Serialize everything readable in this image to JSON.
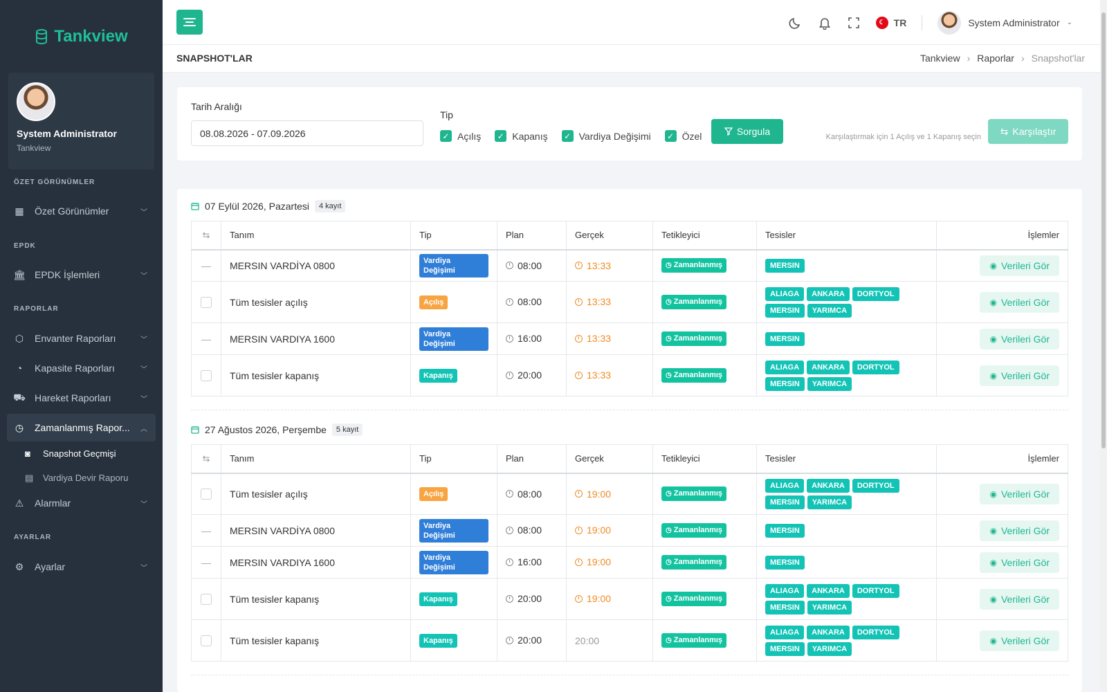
{
  "brand": {
    "name": "Tankview"
  },
  "profile": {
    "name": "System Administrator",
    "org": "Tankview"
  },
  "sidebar": {
    "sections": [
      {
        "title": "ÖZET GÖRÜNÜMLER",
        "items": [
          {
            "label": "Özet Görünümler",
            "icon": "dashboard-icon"
          }
        ]
      },
      {
        "title": "EPDK",
        "items": [
          {
            "label": "EPDK İşlemleri",
            "icon": "bank-icon"
          }
        ]
      },
      {
        "title": "RAPORLAR",
        "items": [
          {
            "label": "Envanter Raporları",
            "icon": "box-icon"
          },
          {
            "label": "Kapasite Raporları",
            "icon": "gauge-icon"
          },
          {
            "label": "Hareket Raporları",
            "icon": "truck-icon"
          },
          {
            "label": "Zamanlanmış Rapor...",
            "icon": "clock-icon",
            "active": true,
            "children": [
              {
                "label": "Snapshot Geçmişi",
                "icon": "camera-icon",
                "active": true
              },
              {
                "label": "Vardiya Devir Raporu",
                "icon": "clipboard-icon"
              }
            ]
          },
          {
            "label": "Alarmlar",
            "icon": "warning-icon"
          }
        ]
      },
      {
        "title": "AYARLAR",
        "items": [
          {
            "label": "Ayarlar",
            "icon": "gear-icon"
          }
        ]
      }
    ]
  },
  "topbar": {
    "language": "TR",
    "user_name": "System Administrator"
  },
  "page": {
    "title": "SNAPSHOT'LAR",
    "breadcrumb": [
      "Tankview",
      "Raporlar",
      "Snapshot'lar"
    ]
  },
  "filter": {
    "date_label": "Tarih Aralığı",
    "date_value": "08.08.2026 - 07.09.2026",
    "type_label": "Tip",
    "types": [
      "Açılış",
      "Kapanış",
      "Vardiya Değişimi",
      "Özel"
    ],
    "query_button": "Sorgula",
    "hint": "Karşılaştırmak için 1 Açılış ve 1 Kapanış seçin",
    "compare_button": "Karşılaştır"
  },
  "table": {
    "columns": [
      "Tanım",
      "Tip",
      "Plan",
      "Gerçek",
      "Tetikleyici",
      "Tesisler",
      "İşlemler"
    ],
    "view_button": "Verileri Gör"
  },
  "groups": [
    {
      "date": "07 Eylül 2026, Pazartesi",
      "count": "4 kayıt",
      "rows": [
        {
          "select": "dash",
          "name": "MERSIN VARDİYA 0800",
          "type": "Vardiya Değişimi",
          "type_kind": "vd",
          "plan": "08:00",
          "actual": "13:33",
          "actual_kind": "orange",
          "trigger": "Zamanlanmış",
          "facilities": [
            "MERSIN"
          ]
        },
        {
          "select": "box",
          "name": "Tüm tesisler açılış",
          "type": "Açılış",
          "type_kind": "ac",
          "plan": "08:00",
          "actual": "13:33",
          "actual_kind": "orange",
          "trigger": "Zamanlanmış",
          "facilities": [
            "ALIAGA",
            "ANKARA",
            "DORTYOL",
            "MERSIN",
            "YARIMCA"
          ]
        },
        {
          "select": "dash",
          "name": "MERSIN VARDIYA 1600",
          "type": "Vardiya Değişimi",
          "type_kind": "vd",
          "plan": "16:00",
          "actual": "13:33",
          "actual_kind": "orange",
          "trigger": "Zamanlanmış",
          "facilities": [
            "MERSIN"
          ]
        },
        {
          "select": "box",
          "name": "Tüm tesisler kapanış",
          "type": "Kapanış",
          "type_kind": "kp",
          "plan": "20:00",
          "actual": "13:33",
          "actual_kind": "orange",
          "trigger": "Zamanlanmış",
          "facilities": [
            "ALIAGA",
            "ANKARA",
            "DORTYOL",
            "MERSIN",
            "YARIMCA"
          ]
        }
      ]
    },
    {
      "date": "27 Ağustos 2026, Perşembe",
      "count": "5 kayıt",
      "rows": [
        {
          "select": "box",
          "name": "Tüm tesisler açılış",
          "type": "Açılış",
          "type_kind": "ac",
          "plan": "08:00",
          "actual": "19:00",
          "actual_kind": "orange",
          "trigger": "Zamanlanmış",
          "facilities": [
            "ALIAGA",
            "ANKARA",
            "DORTYOL",
            "MERSIN",
            "YARIMCA"
          ]
        },
        {
          "select": "dash",
          "name": "MERSIN VARDİYA 0800",
          "type": "Vardiya Değişimi",
          "type_kind": "vd",
          "plan": "08:00",
          "actual": "19:00",
          "actual_kind": "orange",
          "trigger": "Zamanlanmış",
          "facilities": [
            "MERSIN"
          ]
        },
        {
          "select": "dash",
          "name": "MERSIN VARDIYA 1600",
          "type": "Vardiya Değişimi",
          "type_kind": "vd",
          "plan": "16:00",
          "actual": "19:00",
          "actual_kind": "orange",
          "trigger": "Zamanlanmış",
          "facilities": [
            "MERSIN"
          ]
        },
        {
          "select": "box",
          "name": "Tüm tesisler kapanış",
          "type": "Kapanış",
          "type_kind": "kp",
          "plan": "20:00",
          "actual": "19:00",
          "actual_kind": "orange",
          "trigger": "Zamanlanmış",
          "facilities": [
            "ALIAGA",
            "ANKARA",
            "DORTYOL",
            "MERSIN",
            "YARIMCA"
          ]
        },
        {
          "select": "box",
          "name": "Tüm tesisler kapanış",
          "type": "Kapanış",
          "type_kind": "kp",
          "plan": "20:00",
          "actual": "20:00",
          "actual_kind": "grey",
          "trigger": "Zamanlanmış",
          "facilities": [
            "ALIAGA",
            "ANKARA",
            "DORTYOL",
            "MERSIN",
            "YARIMCA"
          ]
        }
      ]
    }
  ],
  "colors": {
    "accent": "#1fb68f",
    "sidebar": "#27313d",
    "vardiya": "#2f7ed8",
    "acilis": "#f7a441",
    "kapanis": "#13c3b5",
    "late": "#f28a21"
  }
}
